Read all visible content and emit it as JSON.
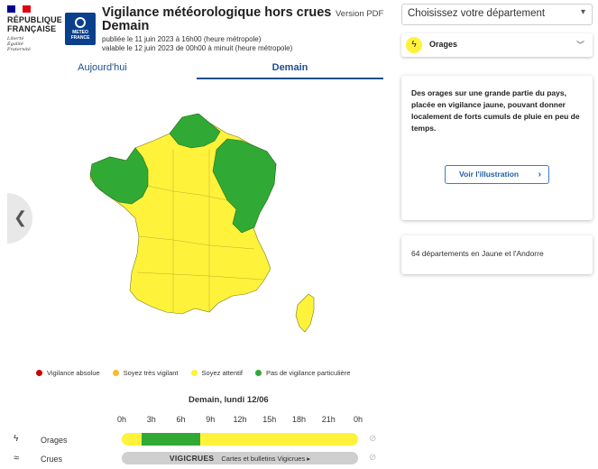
{
  "colors": {
    "yellow": "#fff23a",
    "green": "#31aa35",
    "orange": "#ffb82b",
    "red": "#cc0000",
    "accent": "#1e4f8c"
  },
  "header": {
    "republique_line1": "RÉPUBLIQUE",
    "republique_line2": "FRANÇAISE",
    "motto_1": "Liberté",
    "motto_2": "Égalité",
    "motto_3": "Fraternité",
    "meteo_line1": "METEO",
    "meteo_line2": "FRANCE",
    "title_line1": "Vigilance météorologique hors crues",
    "title_line2": "Demain",
    "published": "publiée le 11 juin 2023 à 16h00 (heure métropole)",
    "valid": "valable le 12 juin 2023 de 00h00 à minuit (heure métropole)",
    "pdf_link": "Version PDF"
  },
  "tabs": [
    {
      "label": "Aujourd'hui",
      "active": false
    },
    {
      "label": "Demain",
      "active": true
    }
  ],
  "nav": {
    "prev_icon": "chevron-left-icon"
  },
  "legend": [
    {
      "label": "Vigilance absolue",
      "color": "#cc0000"
    },
    {
      "label": "Soyez très vigilant",
      "color": "#ffb82b"
    },
    {
      "label": "Soyez attentif",
      "color": "#fff23a"
    },
    {
      "label": "Pas de vigilance particulière",
      "color": "#31aa35"
    }
  ],
  "timeline": {
    "day_label": "Demain, lundi 12/06",
    "ticks": [
      "0h",
      "3h",
      "6h",
      "9h",
      "12h",
      "15h",
      "18h",
      "21h",
      "0h"
    ],
    "rows": [
      {
        "label": "Orages",
        "icon": "lightning-icon",
        "segments": [
          {
            "from_h": 0,
            "to_h": 2,
            "color": "yellow"
          },
          {
            "from_h": 2,
            "to_h": 8,
            "color": "green"
          },
          {
            "from_h": 8,
            "to_h": 24,
            "color": "yellow"
          }
        ]
      }
    ],
    "crues": {
      "label": "Crues",
      "icon": "waves-icon",
      "brand": "VIGICRUES",
      "link": "Cartes et bulletins Vigicrues ▸"
    }
  },
  "sidebar": {
    "select_placeholder": "Choisissez votre département",
    "phenomenon": "Orages",
    "description": "Des orages sur une grande partie du pays, placée en vigilance jaune, pouvant donner localement de forts cumuls de pluie en peu de temps.",
    "illustration_button": "Voir l'illustration",
    "summary": "64 départements en Jaune et l'Andorre"
  }
}
